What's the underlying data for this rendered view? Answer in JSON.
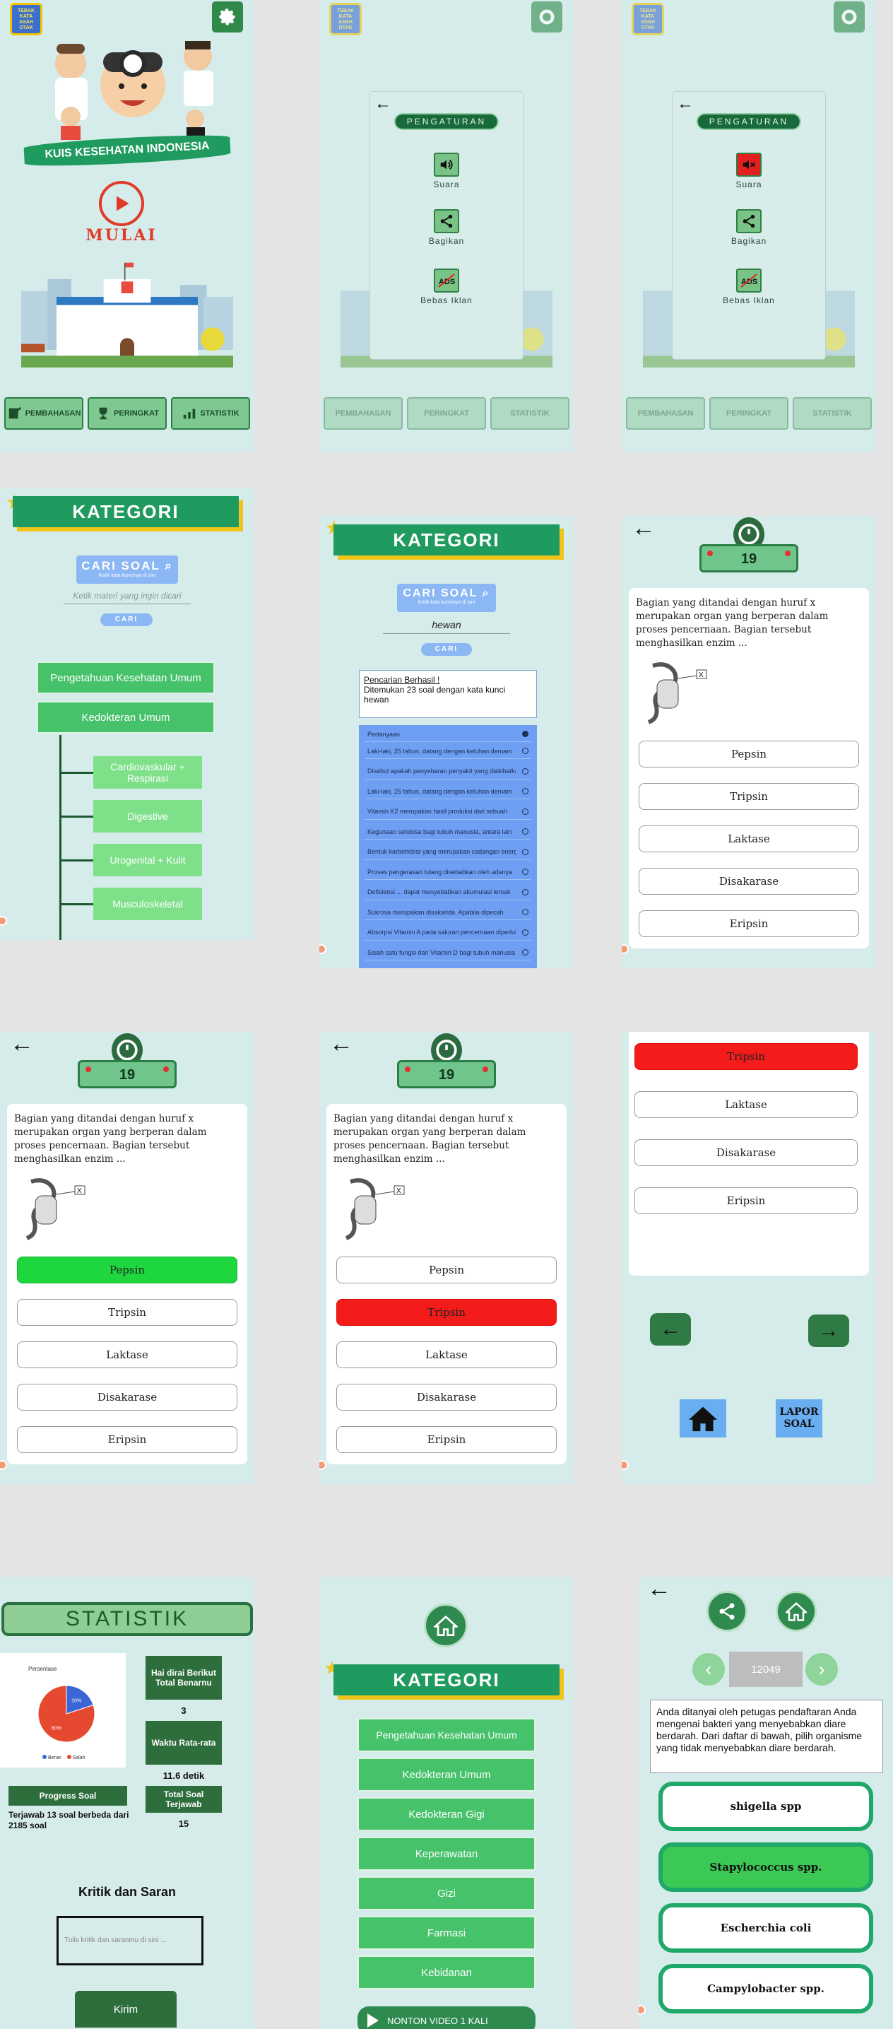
{
  "home": {
    "logo_lines": [
      "TEBAK",
      "KATA",
      "ASAH",
      "OTAK"
    ],
    "title": "KUIS KESEHATAN INDONESIA",
    "start_label": "MULAI",
    "nav": [
      {
        "label": "PEMBAHASAN",
        "icon": "book-icon"
      },
      {
        "label": "PERINGKAT",
        "icon": "trophy-icon"
      },
      {
        "label": "STATISTIK",
        "icon": "chart-icon"
      }
    ]
  },
  "settings": {
    "title": "PENGATURAN",
    "items": [
      {
        "label": "Suara",
        "icon": "speaker-icon"
      },
      {
        "label": "Bagikan",
        "icon": "share-icon"
      },
      {
        "label": "Bebas Iklan",
        "icon": "ads-icon"
      }
    ],
    "muted_color": "#e41f1f"
  },
  "kategori": {
    "title": "KATEGORI",
    "search_label": "CARI SOAL",
    "search_hint": "Ketik kata kuncinya di sini",
    "input_placeholder": "Ketik materi yang ingin dicari",
    "search_value": "hewan",
    "cari_button": "CARI",
    "tree": [
      "Pengetahuan Kesehatan Umum",
      "Kedokteran Umum"
    ],
    "sub": [
      "Cardiovaskular + Respirasi",
      "Digestive",
      "Urogenital + Kulit",
      "Musculoskeletal"
    ]
  },
  "search_result": {
    "title": "Pencarian Berhasil !",
    "message": "Ditemukan 23 soal dengan kata kunci hewan",
    "header": "Pertanyaan",
    "rows": [
      "Laki-laki, 25 tahun, datang dengan keluhan demam",
      "Disebut apakah penyebaran penyakit yang diakibatkan",
      "Laki-laki, 25 tahun, datang dengan keluhan demam",
      "Vitamin K2 merupakan hasil produksi dari sebuah",
      "Kegunaan selulosa bagi tubuh manusia, antara lain",
      "Bentuk karbohidrat yang merupakan cadangan energi",
      "Proses pengerasan tulang disebabkan oleh adanya",
      "Defisiensi ... dapat menyebabkan akumulasi lemak",
      "Sukrosa merupakan disakarida. Apabila dipecah",
      "Absorpsi Vitamin A pada saluran pencernaan diperlukan",
      "Salah satu fungsi dari Vitamin D bagi tubuh manusia"
    ]
  },
  "quiz": {
    "timer": "19",
    "question": "Bagian yang ditandai dengan huruf x merupakan organ yang berperan dalam proses pencernaan. Bagian tersebut menghasilkan enzim ...",
    "marker": "X",
    "options": [
      "Pepsin",
      "Tripsin",
      "Laktase",
      "Disakarase",
      "Eripsin"
    ],
    "correct_color": "#1ed63d",
    "wrong_color": "#f41b1b"
  },
  "review": {
    "options": [
      "Tripsin",
      "Laktase",
      "Disakarase",
      "Eripsin"
    ],
    "report_label_1": "LAPOR",
    "report_label_2": "SOAL"
  },
  "stats": {
    "title": "STATISTIK",
    "pie_title": "Persentase",
    "pie_benar_pct": "20%",
    "pie_salah_pct": "80%",
    "legend_benar": "Benar",
    "legend_salah": "Salah",
    "streak_label": "Hai dirai Berikut Total Benarnu",
    "streak_value": "3",
    "avg_label": "Waktu Rata-rata",
    "avg_value": "11.6 detik",
    "progress_label": "Progress Soal",
    "progress_text": "Terjawab 13 soal berbeda dari 2185 soal",
    "total_label": "Total Soal Terjawab",
    "total_value": "15",
    "feedback_title": "Kritik dan Saran",
    "feedback_placeholder": "Tulis kritik dan saranmu di sini ...",
    "send_label": "Kirim",
    "pie_values": {
      "benar": 20,
      "salah": 80
    }
  },
  "kategori_menu": {
    "title": "KATEGORI",
    "items": [
      "Pengetahuan Kesehatan Umum",
      "Kedokteran Umum",
      "Kedokteran Gigi",
      "Keperawatan",
      "Gizi",
      "Farmasi",
      "Kebidanan"
    ],
    "video_label": "NONTON VIDEO 1 KALI"
  },
  "discussion": {
    "number": "12049",
    "question": "Anda ditanyai oleh petugas pendaftaran Anda mengenai bakteri yang menyebabkan diare berdarah. Dari daftar di bawah, pilih organisme yang tidak menyebabkan diare berdarah.",
    "options": [
      "shigella spp",
      "Stapylococcus spp.",
      "Escherchia coli",
      "Campylobacter spp."
    ]
  }
}
